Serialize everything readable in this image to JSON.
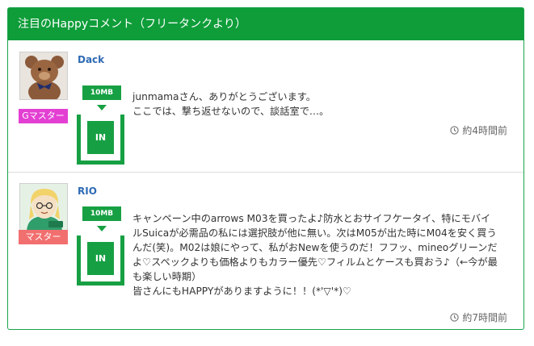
{
  "panel": {
    "title": "注目のHappyコメント（フリータンクより）"
  },
  "comments": [
    {
      "user": "Dack",
      "badge": "Gマスター",
      "data_amount": "10MB",
      "direction": "IN",
      "text": "junmamaさん、ありがとうございます。\nここでは、撃ち返せないので、談話室で…。",
      "time": "約4時間前"
    },
    {
      "user": "RIO",
      "badge": "マスター",
      "data_amount": "10MB",
      "direction": "IN",
      "text": "キャンペーン中のarrows M03を買ったよ♪防水とおサイフケータイ、特にモバイルSuicaが必需品の私には選択肢が他に無い。次はM05が出た時にM04を安く買うんだ(笑)。M02は娘にやって、私がおNewを使うのだ！フフッ、mineoグリーンだよ♡スペックよりも価格よりもカラー優先♡フィルムとケースも買おう♪（←今が最も楽しい時期）\n皆さんにもHAPPYがありますように！！(*'▽'*)♡",
      "time": "約7時間前"
    }
  ],
  "colors": {
    "header_bg": "#0f9d3a",
    "accent_green": "#17a043",
    "username": "#2e6ab5",
    "badge_gmaster": "#e33fd3",
    "badge_master": "#f26f6f"
  },
  "icons": {
    "time": "clock-icon"
  }
}
